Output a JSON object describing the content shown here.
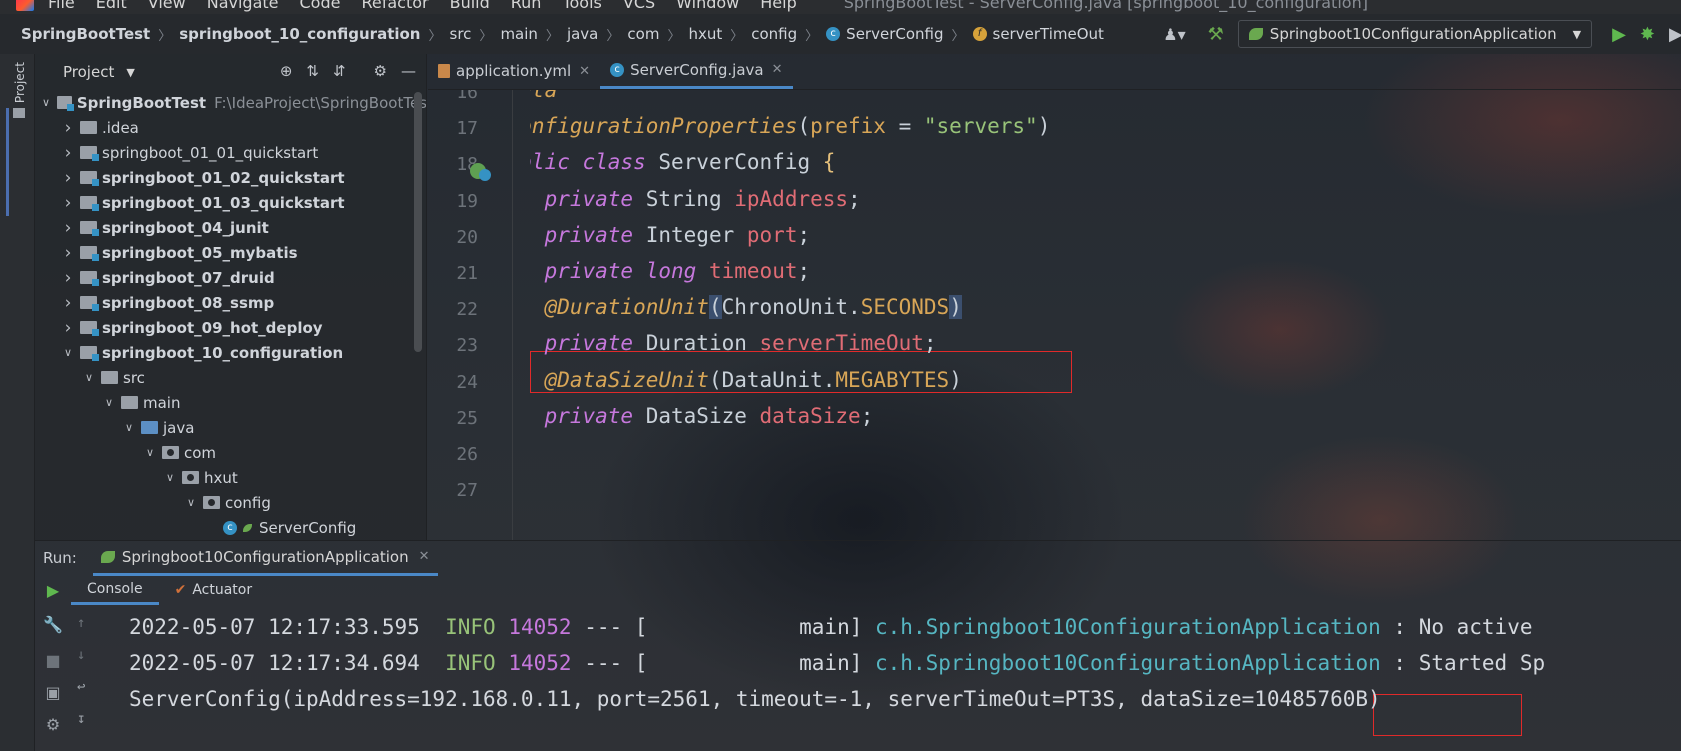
{
  "menu": {
    "items": [
      "File",
      "Edit",
      "View",
      "Navigate",
      "Code",
      "Refactor",
      "Build",
      "Run",
      "Tools",
      "VCS",
      "Window",
      "Help"
    ],
    "window_title": "SpringBootTest - ServerConfig.java [springboot_10_configuration]"
  },
  "breadcrumb": [
    "SpringBootTest",
    "springboot_10_configuration",
    "src",
    "main",
    "java",
    "com",
    "hxut",
    "config",
    "ServerConfig",
    "serverTimeOut"
  ],
  "run_config": "Springboot10ConfigurationApplication",
  "sidebar": {
    "label": "Project"
  },
  "project": {
    "title": "Project",
    "root_name": "SpringBootTest",
    "root_path": "F:\\IdeaProject\\SpringBootTes",
    "modules": [
      ".idea",
      "springboot_01_01_quickstart",
      "springboot_01_02_quickstart",
      "springboot_01_03_quickstart",
      "springboot_04_junit",
      "springboot_05_mybatis",
      "springboot_07_druid",
      "springboot_08_ssmp",
      "springboot_09_hot_deploy",
      "springboot_10_configuration"
    ],
    "src": "src",
    "main": "main",
    "java": "java",
    "com": "com",
    "hxut": "hxut",
    "config": "config",
    "serverconfig": "ServerConfig"
  },
  "tabs": [
    {
      "label": "application.yml",
      "active": false
    },
    {
      "label": "ServerConfig.java",
      "active": true
    }
  ],
  "editor": {
    "line_numbers": [
      "16",
      "17",
      "18",
      "19",
      "20",
      "21",
      "22",
      "23",
      "24",
      "25",
      "26",
      "27"
    ],
    "lines": [
      {
        "parts": [
          {
            "t": "@Data",
            "c": "ann"
          }
        ]
      },
      {
        "parts": [
          {
            "t": "@ConfigurationProperties",
            "c": "ann"
          },
          {
            "t": "(",
            "c": ""
          },
          {
            "t": "prefix",
            "c": "const"
          },
          {
            "t": " = ",
            "c": ""
          },
          {
            "t": "\"servers\"",
            "c": "str"
          },
          {
            "t": ")",
            "c": ""
          }
        ]
      },
      {
        "parts": [
          {
            "t": "public",
            "c": "kw"
          },
          {
            "t": " ",
            "c": ""
          },
          {
            "t": "class",
            "c": "kw"
          },
          {
            "t": " ServerConfig ",
            "c": ""
          },
          {
            "t": "{",
            "c": "brace"
          }
        ]
      },
      {
        "parts": [
          {
            "t": "    ",
            "c": ""
          },
          {
            "t": "private",
            "c": "kw"
          },
          {
            "t": " String ",
            "c": ""
          },
          {
            "t": "ipAddress",
            "c": "field"
          },
          {
            "t": ";",
            "c": ""
          }
        ]
      },
      {
        "parts": [
          {
            "t": "    ",
            "c": ""
          },
          {
            "t": "private",
            "c": "kw"
          },
          {
            "t": " Integer ",
            "c": ""
          },
          {
            "t": "port",
            "c": "field"
          },
          {
            "t": ";",
            "c": ""
          }
        ]
      },
      {
        "parts": [
          {
            "t": "    ",
            "c": ""
          },
          {
            "t": "private",
            "c": "kw"
          },
          {
            "t": " ",
            "c": ""
          },
          {
            "t": "long",
            "c": "kw"
          },
          {
            "t": " ",
            "c": ""
          },
          {
            "t": "timeout",
            "c": "field"
          },
          {
            "t": ";",
            "c": ""
          }
        ]
      },
      {
        "parts": [
          {
            "t": "    ",
            "c": ""
          },
          {
            "t": "@DurationUnit",
            "c": "ann"
          },
          {
            "t": "(",
            "c": "parenhl"
          },
          {
            "t": "ChronoUnit.",
            "c": ""
          },
          {
            "t": "SECONDS",
            "c": "const"
          },
          {
            "t": ")",
            "c": "parenhl"
          }
        ]
      },
      {
        "parts": [
          {
            "t": "    ",
            "c": ""
          },
          {
            "t": "private",
            "c": "kw"
          },
          {
            "t": " Duration ",
            "c": ""
          },
          {
            "t": "serverTimeOut",
            "c": "field"
          },
          {
            "t": ";",
            "c": ""
          }
        ]
      },
      {
        "parts": [
          {
            "t": "    ",
            "c": ""
          },
          {
            "t": "@DataSizeUnit",
            "c": "ann"
          },
          {
            "t": "(",
            "c": ""
          },
          {
            "t": "DataUnit.",
            "c": ""
          },
          {
            "t": "MEGABYTES",
            "c": "const"
          },
          {
            "t": ")",
            "c": ""
          }
        ]
      },
      {
        "parts": [
          {
            "t": "    ",
            "c": ""
          },
          {
            "t": "private",
            "c": "kw"
          },
          {
            "t": " DataSize ",
            "c": ""
          },
          {
            "t": "dataSize",
            "c": "field"
          },
          {
            "t": ";",
            "c": ""
          }
        ]
      },
      {
        "parts": [
          {
            "t": "}",
            "c": "brace"
          }
        ]
      },
      {
        "parts": [
          {
            "t": "",
            "c": ""
          }
        ]
      }
    ]
  },
  "run": {
    "label": "Run:",
    "tab": "Springboot10ConfigurationApplication",
    "subtabs": [
      "Console",
      "Actuator"
    ]
  },
  "console": {
    "log_lines": [
      {
        "time": "2022-05-07 12:17:33.595",
        "level": "INFO",
        "pid": "14052",
        "sep": "--- [",
        "thread": "main]",
        "logger": "c.h.Springboot10ConfigurationApplication",
        "msg": ": No active"
      },
      {
        "time": "2022-05-07 12:17:34.694",
        "level": "INFO",
        "pid": "14052",
        "sep": "--- [",
        "thread": "main]",
        "logger": "c.h.Springboot10ConfigurationApplication",
        "msg": ": Started Sp"
      }
    ],
    "output_prefix": "ServerConfig(ipAddress=192.168.0.11, port=2561, timeout=-1, serverTimeOut=PT3S, dataSize=",
    "output_highlight": "10485760B)"
  },
  "colors": {
    "accent": "#4a88c7",
    "highlight_box": "#e02a2a"
  }
}
